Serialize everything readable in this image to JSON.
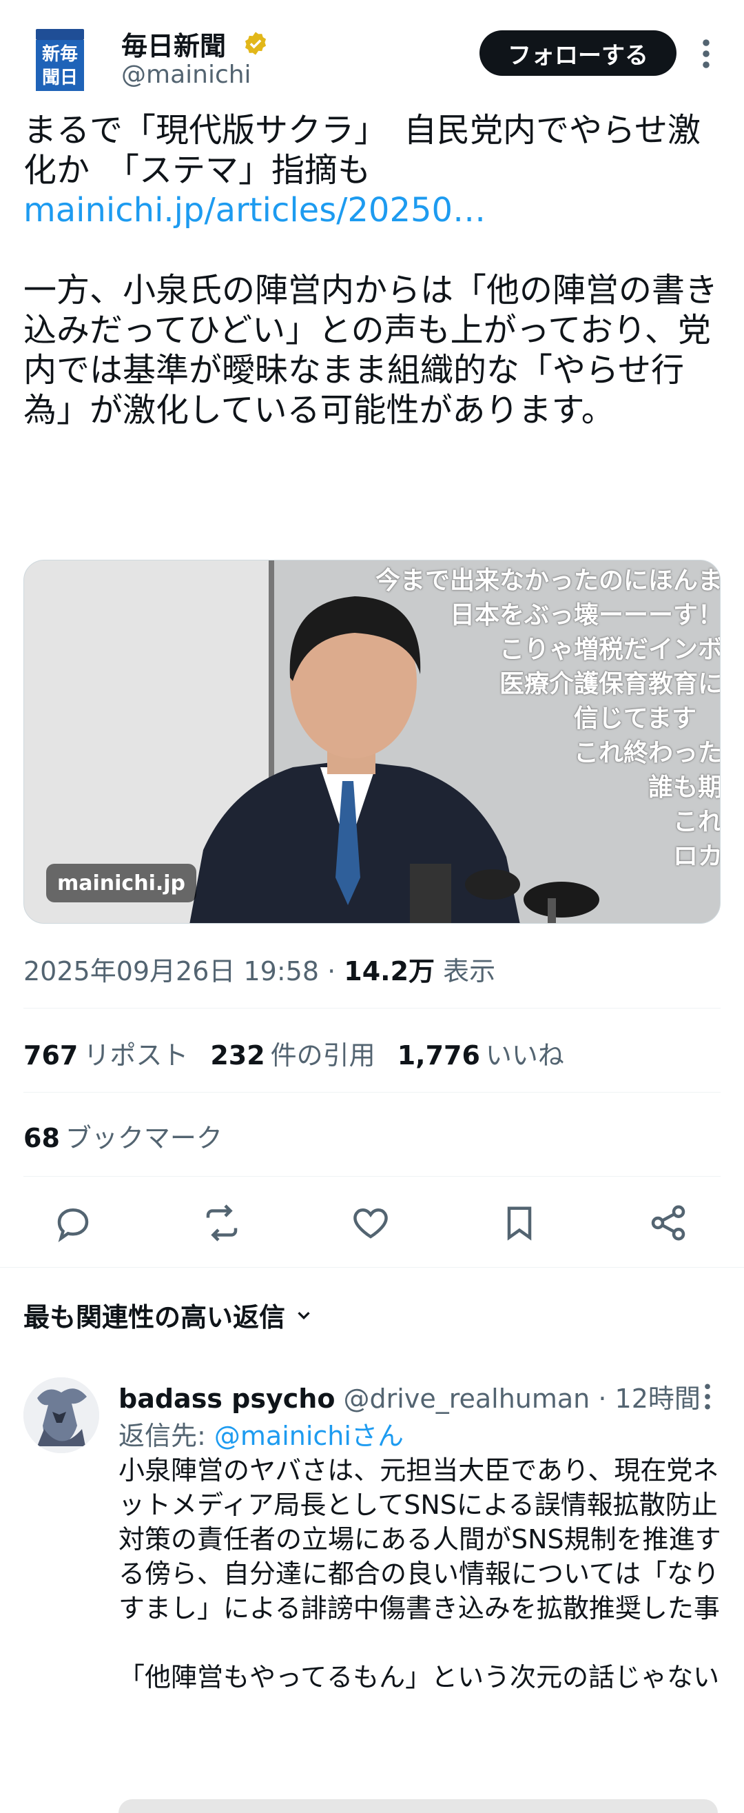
{
  "tweet": {
    "author": {
      "name": "毎日新聞",
      "handle": "@mainichi",
      "logo_text": [
        "新毎",
        "聞日"
      ],
      "verified_color": "#e2b719"
    },
    "follow_label": "フォローする",
    "text": {
      "line1": "まるで「現代版サクラ」　自民党内でやらせ激化か　「ステマ」指摘も",
      "link": "mainichi.jp/articles/20250…",
      "body": "一方、小泉氏の陣営内からは「他の陣営の書き込みだってひどい」との声も上がっており、党内では基準が曖昧なまま組織的な「やらせ行為」が激化している可能性があります。"
    },
    "media": {
      "badge": "mainichi.jp",
      "overlay": [
        "今まで出来なかったのにほんま",
        "日本をぶっ壊ーーーす！",
        "こりゃ増税だインボ",
        "医療介護保育教育に",
        "信じてます",
        "これ終わった",
        "誰も期",
        "これ",
        "ロカ"
      ]
    },
    "timestamp": "2025年09月26日 19:58",
    "views_count": "14.2万",
    "views_label": "表示",
    "stats": {
      "reposts": {
        "count": "767",
        "label": "リポスト"
      },
      "quotes": {
        "count": "232",
        "label": "件の引用"
      },
      "likes": {
        "count": "1,776",
        "label": "いいね"
      },
      "bookmarks": {
        "count": "68",
        "label": "ブックマーク"
      }
    }
  },
  "replies_section": {
    "heading": "最も関連性の高い返信"
  },
  "reply": {
    "name": "badass psycho",
    "handle": "@drive_realhuman",
    "time": "12時間",
    "reply_to_label": "返信先:",
    "reply_to_mention": "@mainichiさん",
    "paragraph1": "小泉陣営のヤバさは、元担当大臣であり、現在党ネットメディア局長としてSNSによる誤情報拡散防止対策の責任者の立場にある人間がSNS規制を推進する傍ら、自分達に都合の良い情報については「なりすまし」による誹謗中傷書き込みを拡散推奨した事",
    "paragraph2": "「他陣営もやってるもん」という次元の話じゃない"
  },
  "colors": {
    "accent": "#1d9bf0",
    "text": "#0f1419",
    "secondary": "#536471"
  }
}
